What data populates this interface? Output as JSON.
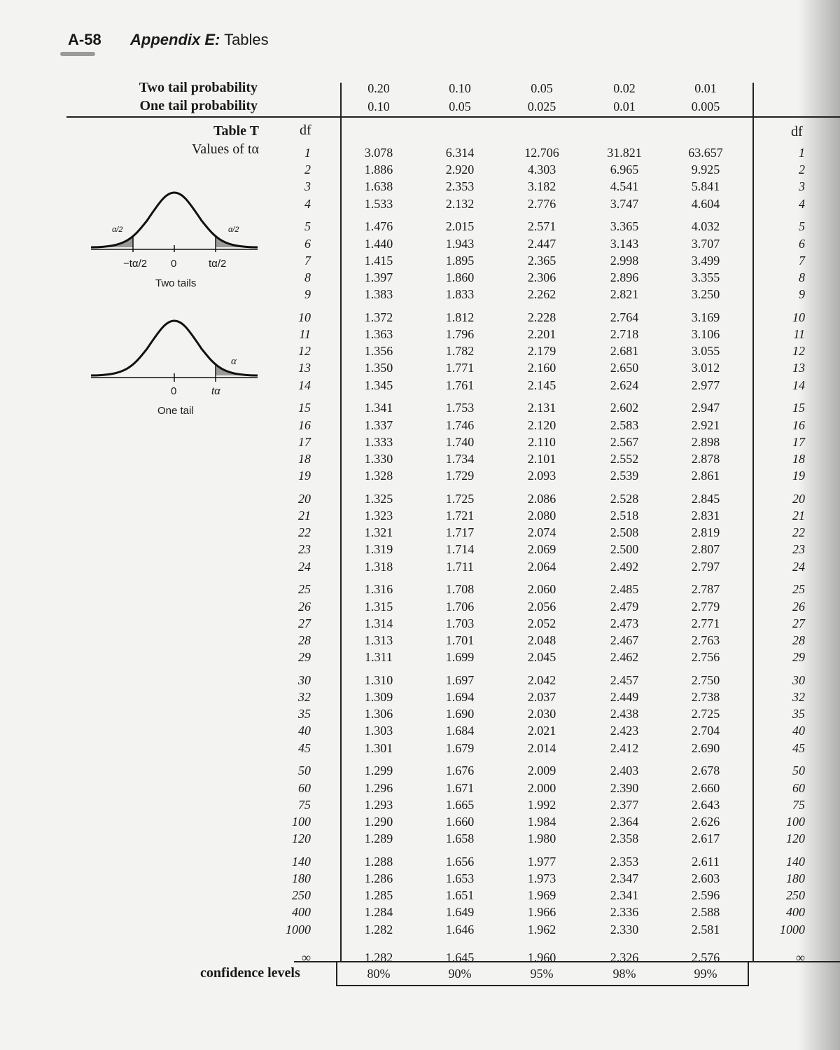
{
  "page": {
    "number": "A-58",
    "appendix": "Appendix E:",
    "section": "Tables"
  },
  "header": {
    "two_tail_label": "Two tail probability",
    "one_tail_label": "One tail probability",
    "two_tail": [
      "0.20",
      "0.10",
      "0.05",
      "0.02",
      "0.01"
    ],
    "one_tail": [
      "0.10",
      "0.05",
      "0.025",
      "0.01",
      "0.005"
    ],
    "df_label": "df",
    "table_title": "Table T",
    "table_subtitle": "Values of tα"
  },
  "figures": {
    "two_tails": {
      "alpha_half": "α/2",
      "neg_t": "−tα/2",
      "zero": "0",
      "pos_t": "tα/2",
      "caption": "Two tails"
    },
    "one_tail": {
      "alpha": "α",
      "zero": "0",
      "t": "tα",
      "caption": "One tail"
    }
  },
  "groups": [
    [
      [
        "1",
        "3.078",
        "6.314",
        "12.706",
        "31.821",
        "63.657"
      ],
      [
        "2",
        "1.886",
        "2.920",
        "4.303",
        "6.965",
        "9.925"
      ],
      [
        "3",
        "1.638",
        "2.353",
        "3.182",
        "4.541",
        "5.841"
      ],
      [
        "4",
        "1.533",
        "2.132",
        "2.776",
        "3.747",
        "4.604"
      ]
    ],
    [
      [
        "5",
        "1.476",
        "2.015",
        "2.571",
        "3.365",
        "4.032"
      ],
      [
        "6",
        "1.440",
        "1.943",
        "2.447",
        "3.143",
        "3.707"
      ],
      [
        "7",
        "1.415",
        "1.895",
        "2.365",
        "2.998",
        "3.499"
      ],
      [
        "8",
        "1.397",
        "1.860",
        "2.306",
        "2.896",
        "3.355"
      ],
      [
        "9",
        "1.383",
        "1.833",
        "2.262",
        "2.821",
        "3.250"
      ]
    ],
    [
      [
        "10",
        "1.372",
        "1.812",
        "2.228",
        "2.764",
        "3.169"
      ],
      [
        "11",
        "1.363",
        "1.796",
        "2.201",
        "2.718",
        "3.106"
      ],
      [
        "12",
        "1.356",
        "1.782",
        "2.179",
        "2.681",
        "3.055"
      ],
      [
        "13",
        "1.350",
        "1.771",
        "2.160",
        "2.650",
        "3.012"
      ],
      [
        "14",
        "1.345",
        "1.761",
        "2.145",
        "2.624",
        "2.977"
      ]
    ],
    [
      [
        "15",
        "1.341",
        "1.753",
        "2.131",
        "2.602",
        "2.947"
      ],
      [
        "16",
        "1.337",
        "1.746",
        "2.120",
        "2.583",
        "2.921"
      ],
      [
        "17",
        "1.333",
        "1.740",
        "2.110",
        "2.567",
        "2.898"
      ],
      [
        "18",
        "1.330",
        "1.734",
        "2.101",
        "2.552",
        "2.878"
      ],
      [
        "19",
        "1.328",
        "1.729",
        "2.093",
        "2.539",
        "2.861"
      ]
    ],
    [
      [
        "20",
        "1.325",
        "1.725",
        "2.086",
        "2.528",
        "2.845"
      ],
      [
        "21",
        "1.323",
        "1.721",
        "2.080",
        "2.518",
        "2.831"
      ],
      [
        "22",
        "1.321",
        "1.717",
        "2.074",
        "2.508",
        "2.819"
      ],
      [
        "23",
        "1.319",
        "1.714",
        "2.069",
        "2.500",
        "2.807"
      ],
      [
        "24",
        "1.318",
        "1.711",
        "2.064",
        "2.492",
        "2.797"
      ]
    ],
    [
      [
        "25",
        "1.316",
        "1.708",
        "2.060",
        "2.485",
        "2.787"
      ],
      [
        "26",
        "1.315",
        "1.706",
        "2.056",
        "2.479",
        "2.779"
      ],
      [
        "27",
        "1.314",
        "1.703",
        "2.052",
        "2.473",
        "2.771"
      ],
      [
        "28",
        "1.313",
        "1.701",
        "2.048",
        "2.467",
        "2.763"
      ],
      [
        "29",
        "1.311",
        "1.699",
        "2.045",
        "2.462",
        "2.756"
      ]
    ],
    [
      [
        "30",
        "1.310",
        "1.697",
        "2.042",
        "2.457",
        "2.750"
      ],
      [
        "32",
        "1.309",
        "1.694",
        "2.037",
        "2.449",
        "2.738"
      ],
      [
        "35",
        "1.306",
        "1.690",
        "2.030",
        "2.438",
        "2.725"
      ],
      [
        "40",
        "1.303",
        "1.684",
        "2.021",
        "2.423",
        "2.704"
      ],
      [
        "45",
        "1.301",
        "1.679",
        "2.014",
        "2.412",
        "2.690"
      ]
    ],
    [
      [
        "50",
        "1.299",
        "1.676",
        "2.009",
        "2.403",
        "2.678"
      ],
      [
        "60",
        "1.296",
        "1.671",
        "2.000",
        "2.390",
        "2.660"
      ],
      [
        "75",
        "1.293",
        "1.665",
        "1.992",
        "2.377",
        "2.643"
      ],
      [
        "100",
        "1.290",
        "1.660",
        "1.984",
        "2.364",
        "2.626"
      ],
      [
        "120",
        "1.289",
        "1.658",
        "1.980",
        "2.358",
        "2.617"
      ]
    ],
    [
      [
        "140",
        "1.288",
        "1.656",
        "1.977",
        "2.353",
        "2.611"
      ],
      [
        "180",
        "1.286",
        "1.653",
        "1.973",
        "2.347",
        "2.603"
      ],
      [
        "250",
        "1.285",
        "1.651",
        "1.969",
        "2.341",
        "2.596"
      ],
      [
        "400",
        "1.284",
        "1.649",
        "1.966",
        "2.336",
        "2.588"
      ],
      [
        "1000",
        "1.282",
        "1.646",
        "1.962",
        "2.330",
        "2.581"
      ]
    ],
    [
      [
        "∞",
        "1.282",
        "1.645",
        "1.960",
        "2.326",
        "2.576"
      ]
    ]
  ],
  "confidence": {
    "label": "confidence levels",
    "levels": [
      "80%",
      "90%",
      "95%",
      "98%",
      "99%"
    ]
  }
}
